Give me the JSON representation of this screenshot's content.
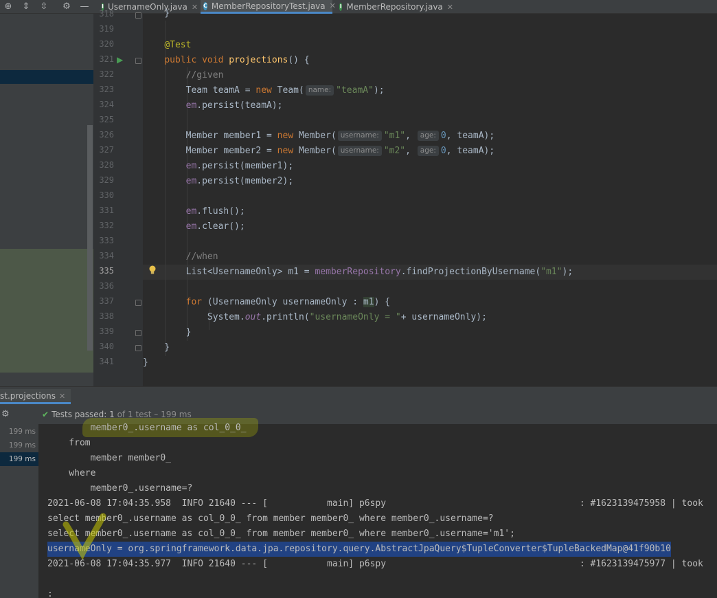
{
  "tabs": [
    {
      "label": "UsernameOnly.java",
      "icon": "interface-icon",
      "badge": "I",
      "active": false
    },
    {
      "label": "MemberRepositoryTest.java",
      "icon": "class-icon",
      "badge": "C",
      "active": true
    },
    {
      "label": "MemberRepository.java",
      "icon": "interface-icon",
      "badge": "I",
      "active": false
    }
  ],
  "editor": {
    "line_numbers": [
      "318",
      "319",
      "320",
      "321",
      "322",
      "323",
      "324",
      "325",
      "326",
      "327",
      "328",
      "329",
      "330",
      "331",
      "332",
      "333",
      "334",
      "335",
      "336",
      "337",
      "338",
      "339",
      "340",
      "341"
    ],
    "current_line": "335",
    "hints": {
      "name": "name:",
      "username": "username:",
      "age": "age:"
    },
    "tokens": {
      "ann_test": "@Test",
      "kw_public": "public",
      "kw_void": "void",
      "method_projections": "projections",
      "cm_given": "//given",
      "cm_when": "//when",
      "kw_new": "new",
      "kw_for": "for",
      "str_teamA": "\"teamA\"",
      "str_m1": "\"m1\"",
      "str_m2": "\"m2\"",
      "str_usernameOnly": "\"usernameOnly = \"",
      "num_0": "0",
      "em": "em",
      "memberRepository": "memberRepository",
      "out": "out"
    }
  },
  "run_panel": {
    "tab_label": "st.projections",
    "status_prefix": "Tests passed:",
    "status_count": "1",
    "status_suffix": "of 1 test – 199 ms",
    "test_times": [
      "199 ms",
      "199 ms",
      "199 ms"
    ],
    "console_lines": [
      "        member0_.username as col_0_0_",
      "    from",
      "        member member0_",
      "    where",
      "        member0_.username=?",
      "2021-06-08 17:04:35.958  INFO 21640 --- [           main] p6spy                                    : #1623139475958 | took",
      "select member0_.username as col_0_0_ from member member0_ where member0_.username=?",
      "select member0_.username as col_0_0_ from member member0_ where member0_.username='m1';",
      "usernameOnly = org.springframework.data.jpa.repository.query.AbstractJpaQuery$TupleConverter$TupleBackedMap@41f90b10",
      "2021-06-08 17:04:35.977  INFO 21640 --- [           main] p6spy                                    : #1623139475977 | took",
      "",
      ":"
    ]
  }
}
